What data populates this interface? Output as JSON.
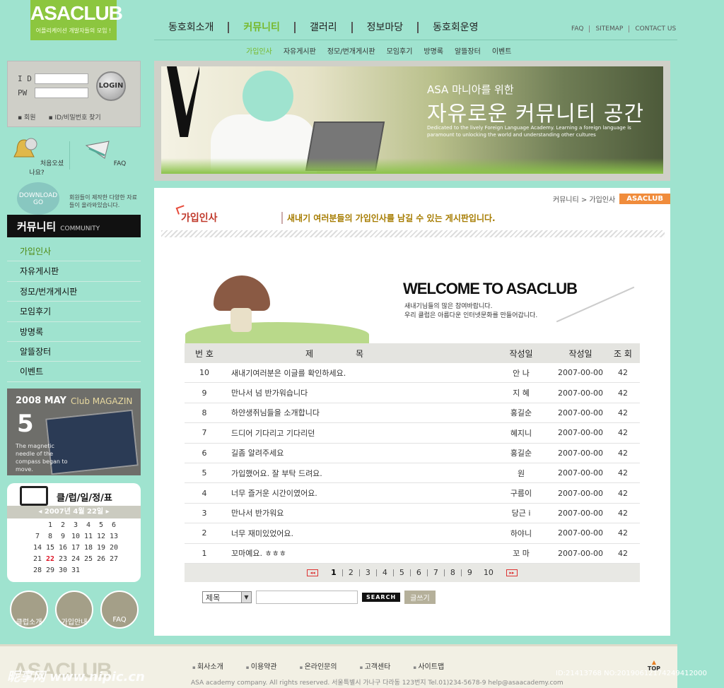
{
  "logo": {
    "brand": "ASACLUB",
    "tagline": "어플리케이션 개발자들의 모임 !"
  },
  "main_nav": [
    "동호회소개",
    "커뮤니티",
    "갤러리",
    "정보마당",
    "동호회운영"
  ],
  "util_links": [
    "FAQ",
    "SITEMAP",
    "CONTACT US"
  ],
  "sub_nav": [
    "가입인사",
    "자유게시판",
    "정모/번개게시판",
    "모임후기",
    "방명록",
    "알뜰장터",
    "이벤트"
  ],
  "login": {
    "id_label": "I D",
    "pw_label": "PW",
    "button": "LOGIN",
    "member_link": "회원",
    "find_link": "ID/비밀번호 찾기"
  },
  "quick": {
    "first_visit": "처음오셨나요?",
    "faq": "FAQ"
  },
  "download": {
    "label": "DOWNLOAD",
    "go": "GO",
    "text": "회원들이 제작한 다양한 자료들이 올라와있습니다."
  },
  "community": {
    "title": "커뮤니티",
    "subtitle": "COMMUNITY"
  },
  "side_menu": [
    "가입인사",
    "자유게시판",
    "정모/번개게시판",
    "모임후기",
    "방명록",
    "알뜰장터",
    "이벤트"
  ],
  "magazine": {
    "date": "2008 MAY",
    "name": "Club MAGAZIN",
    "number": "5",
    "text": "The magnetic needle of the compass began to move."
  },
  "calendar": {
    "title": "클/럽/일/정/표",
    "header": "◂  2007년  4월  22일  ▸",
    "weeks": [
      [
        "",
        "1",
        "2",
        "3",
        "4",
        "5",
        "6"
      ],
      [
        "7",
        "8",
        "9",
        "10",
        "11",
        "12",
        "13"
      ],
      [
        "14",
        "15",
        "16",
        "17",
        "18",
        "19",
        "20"
      ],
      [
        "21",
        "22",
        "23",
        "24",
        "25",
        "26",
        "27"
      ],
      [
        "28",
        "29",
        "30",
        "31",
        "",
        "",
        ""
      ]
    ],
    "today": "22"
  },
  "circle_buttons": [
    "클럽소개",
    "가입안내",
    "FAQ"
  ],
  "banner": {
    "line1": "ASA 마니아를 위한",
    "line2": "자유로운 커뮤니티 공간",
    "line3": "Dedicated to the lively Foreign Language Academy. Learning a foreign language is paramount to unlocking the world and understanding other cultures"
  },
  "breadcrumb": {
    "path": "커뮤니티 > 가입인사",
    "tag": "ASACLUB"
  },
  "page": {
    "title": "가입인사",
    "desc": "새내기 여러분들의 가입인사를 남길 수 있는 게시판입니다."
  },
  "welcome": {
    "title": "WELCOME TO ASACLUB",
    "line1": "새내기님들의 많은 참여바랍니다.",
    "line2": "우리 클럽은 아름다운 인터넷문화를 만들어갑니다."
  },
  "board": {
    "headers": {
      "no": "번 호",
      "title": "제목",
      "author": "작성일",
      "date": "작성일",
      "views": "조 회"
    },
    "rows": [
      {
        "no": "10",
        "title": "새내기여러분은 이글를 확인하세요.",
        "author": "안 나",
        "date": "2007-00-00",
        "views": "42"
      },
      {
        "no": "9",
        "title": "만나서 넘 반가워습니다",
        "author": "지 혜",
        "date": "2007-00-00",
        "views": "42"
      },
      {
        "no": "8",
        "title": "하얀생쥐님들을 소개합니다",
        "author": "홍길순",
        "date": "2007-00-00",
        "views": "42"
      },
      {
        "no": "7",
        "title": "드디어 기다리고 기다리던",
        "author": "혜지니",
        "date": "2007-00-00",
        "views": "42"
      },
      {
        "no": "6",
        "title": "길좀 알려주세요",
        "author": "홍길순",
        "date": "2007-00-00",
        "views": "42"
      },
      {
        "no": "5",
        "title": "가입했어요. 잘 부탁 드려요.",
        "author": "원",
        "date": "2007-00-00",
        "views": "42"
      },
      {
        "no": "4",
        "title": "너무 즐거운 시간이였어요.",
        "author": "구름이",
        "date": "2007-00-00",
        "views": "42"
      },
      {
        "no": "3",
        "title": "만나서 반가워요",
        "author": "당근 i",
        "date": "2007-00-00",
        "views": "42"
      },
      {
        "no": "2",
        "title": "너무 재미있었어요.",
        "author": "하야니",
        "date": "2007-00-00",
        "views": "42"
      },
      {
        "no": "1",
        "title": "꼬마예요. ㅎㅎㅎ",
        "author": "꼬  마",
        "date": "2007-00-00",
        "views": "42"
      }
    ]
  },
  "pager": {
    "pages": [
      "1",
      "2",
      "3",
      "4",
      "5",
      "6",
      "7",
      "8",
      "9",
      "10"
    ],
    "current": "1",
    "prev": "◂◂",
    "next": "▸▸"
  },
  "search": {
    "select_value": "제목",
    "search_button": "SEARCH",
    "write_button": "글쓰기"
  },
  "footer": {
    "logo": "ASACLUB",
    "links": [
      "회사소개",
      "이용약관",
      "온라인문의",
      "고객센타",
      "사이트맵"
    ],
    "copyright": "ASA academy company. All rights reserved.     서울특별시 가나구 다라동 123번지    Tel.01)234-5678-9   help@asaacademy.com",
    "top": "TOP"
  },
  "watermark": {
    "site": "昵享网 www.nipic.cn",
    "id": "ID:21413768 NO:20190612174249412000"
  }
}
